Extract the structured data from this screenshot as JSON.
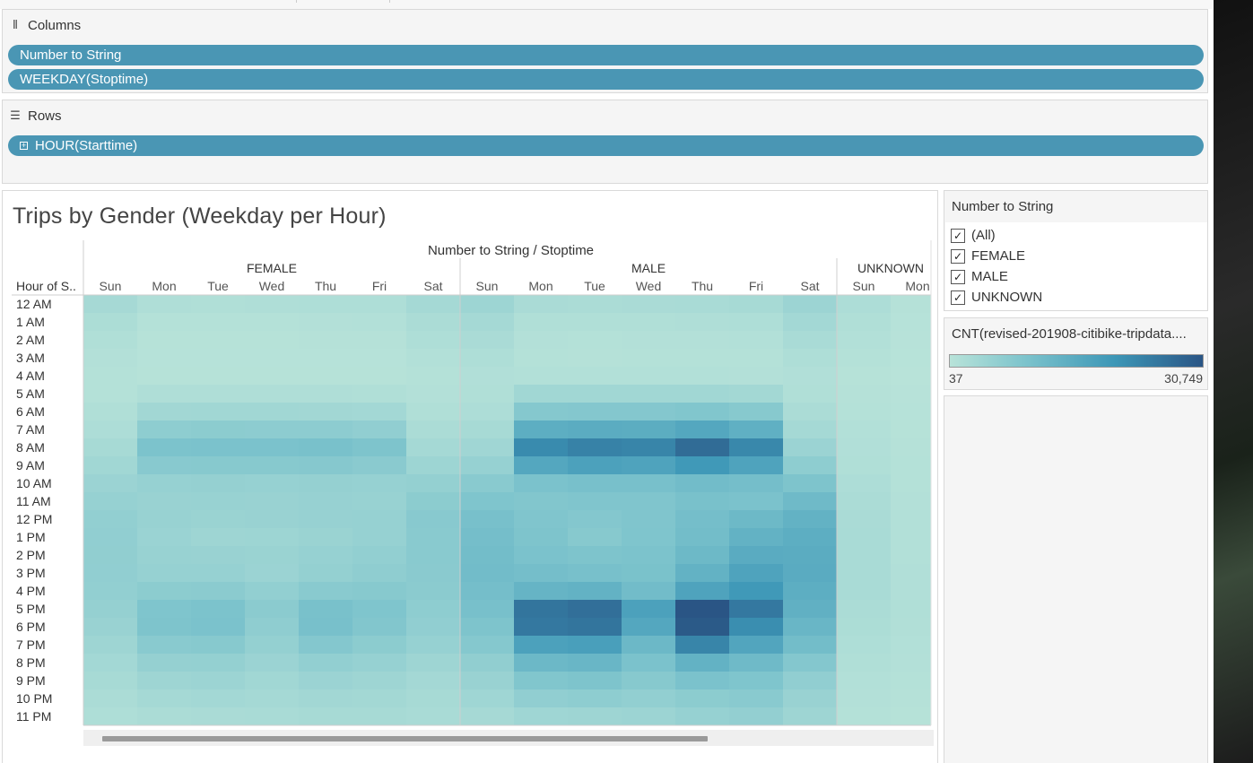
{
  "columns_shelf": {
    "label": "Columns",
    "pills": [
      "Number to String",
      "WEEKDAY(Stoptime)"
    ]
  },
  "rows_shelf": {
    "label": "Rows",
    "pills": [
      "HOUR(Starttime)"
    ]
  },
  "view": {
    "title": "Trips by Gender  (Weekday per Hour)",
    "header_title": "Number to String / Stoptime",
    "row_header": "Hour of S..",
    "groups": [
      "FEMALE",
      "MALE",
      "UNKNOWN"
    ],
    "days": [
      "Sun",
      "Mon",
      "Tue",
      "Wed",
      "Thu",
      "Fri",
      "Sat"
    ],
    "hours": [
      "12 AM",
      "1 AM",
      "2 AM",
      "3 AM",
      "4 AM",
      "5 AM",
      "6 AM",
      "7 AM",
      "8 AM",
      "9 AM",
      "10 AM",
      "11 AM",
      "12 PM",
      "1 PM",
      "2 PM",
      "3 PM",
      "4 PM",
      "5 PM",
      "6 PM",
      "7 PM",
      "8 PM",
      "9 PM",
      "10 PM",
      "11 PM"
    ]
  },
  "filter_card": {
    "title": "Number to String",
    "items": [
      {
        "label": "(All)",
        "checked": true
      },
      {
        "label": "FEMALE",
        "checked": true
      },
      {
        "label": "MALE",
        "checked": true
      },
      {
        "label": "UNKNOWN",
        "checked": true
      }
    ]
  },
  "legend_card": {
    "title": "CNT(revised-201908-citibike-tripdata....",
    "min_label": "37",
    "max_label": "30,749",
    "colors": [
      "#b8e3d9",
      "#7cc3cc",
      "#3d97b7",
      "#2a5585"
    ]
  },
  "chart_data": {
    "type": "heatmap",
    "title": "Trips by Gender  (Weekday per Hour)",
    "x_title": "Number to String / Stoptime",
    "y_label": "Hour of S..",
    "value_range": [
      37,
      30749
    ],
    "columns": [
      {
        "group": "FEMALE",
        "day": "Sun"
      },
      {
        "group": "FEMALE",
        "day": "Mon"
      },
      {
        "group": "FEMALE",
        "day": "Tue"
      },
      {
        "group": "FEMALE",
        "day": "Wed"
      },
      {
        "group": "FEMALE",
        "day": "Thu"
      },
      {
        "group": "FEMALE",
        "day": "Fri"
      },
      {
        "group": "FEMALE",
        "day": "Sat"
      },
      {
        "group": "MALE",
        "day": "Sun"
      },
      {
        "group": "MALE",
        "day": "Mon"
      },
      {
        "group": "MALE",
        "day": "Tue"
      },
      {
        "group": "MALE",
        "day": "Wed"
      },
      {
        "group": "MALE",
        "day": "Thu"
      },
      {
        "group": "MALE",
        "day": "Fri"
      },
      {
        "group": "MALE",
        "day": "Sat"
      },
      {
        "group": "UNKNOWN",
        "day": "Sun"
      },
      {
        "group": "UNKNOWN",
        "day": "Mon"
      }
    ],
    "rows": [
      "12 AM",
      "1 AM",
      "2 AM",
      "3 AM",
      "4 AM",
      "5 AM",
      "6 AM",
      "7 AM",
      "8 AM",
      "9 AM",
      "10 AM",
      "11 AM",
      "12 PM",
      "1 PM",
      "2 PM",
      "3 PM",
      "4 PM",
      "5 PM",
      "6 PM",
      "7 PM",
      "8 PM",
      "9 PM",
      "10 PM",
      "11 PM"
    ],
    "values": [
      [
        2800,
        1400,
        1300,
        1400,
        1500,
        1600,
        2900,
        4200,
        2200,
        2100,
        2200,
        2400,
        2600,
        4400,
        1800,
        500
      ],
      [
        1900,
        700,
        700,
        700,
        800,
        900,
        2100,
        3000,
        1300,
        1200,
        1300,
        1400,
        1600,
        3200,
        1200,
        300
      ],
      [
        1300,
        400,
        400,
        400,
        500,
        500,
        1500,
        2200,
        800,
        700,
        800,
        800,
        900,
        2300,
        900,
        200
      ],
      [
        800,
        300,
        300,
        300,
        300,
        300,
        900,
        1500,
        600,
        500,
        600,
        600,
        600,
        1600,
        600,
        150
      ],
      [
        600,
        400,
        400,
        400,
        400,
        400,
        600,
        1100,
        900,
        900,
        900,
        900,
        800,
        1100,
        400,
        100
      ],
      [
        700,
        1400,
        1400,
        1400,
        1400,
        1300,
        800,
        1200,
        3500,
        3500,
        3500,
        3500,
        3300,
        1300,
        500,
        200
      ],
      [
        1200,
        3400,
        3500,
        3500,
        3400,
        3200,
        1300,
        1800,
        7800,
        8000,
        8000,
        8500,
        7500,
        2000,
        700,
        300
      ],
      [
        1800,
        6500,
        6800,
        6700,
        6600,
        6000,
        2000,
        2600,
        14500,
        14800,
        14700,
        16000,
        14000,
        3000,
        900,
        400
      ],
      [
        2600,
        9300,
        9500,
        9400,
        9800,
        9000,
        3000,
        3700,
        22000,
        23500,
        23000,
        27000,
        22500,
        4500,
        1100,
        500
      ],
      [
        3600,
        7400,
        7600,
        7500,
        7700,
        7100,
        4200,
        5200,
        16000,
        17500,
        17000,
        19500,
        17000,
        6500,
        1300,
        600
      ],
      [
        4500,
        5200,
        5400,
        5300,
        5400,
        5200,
        5600,
        7200,
        9500,
        10000,
        10000,
        11000,
        10500,
        9000,
        1700,
        700
      ],
      [
        5200,
        4800,
        4900,
        4800,
        5100,
        5000,
        6800,
        8800,
        8300,
        8700,
        8600,
        9800,
        9500,
        11500,
        2000,
        800
      ],
      [
        5800,
        4900,
        4700,
        4800,
        5100,
        5300,
        7400,
        10000,
        8700,
        8000,
        8600,
        10500,
        11800,
        13500,
        2200,
        900
      ],
      [
        6000,
        4600,
        4000,
        4200,
        4700,
        5300,
        7200,
        10500,
        9000,
        7600,
        8800,
        10800,
        13500,
        14500,
        2300,
        950
      ],
      [
        6100,
        4900,
        4800,
        4700,
        5300,
        5900,
        7300,
        10800,
        9500,
        8900,
        9200,
        11800,
        15000,
        14800,
        2400,
        1000
      ],
      [
        6000,
        5300,
        5300,
        4500,
        5600,
        6300,
        7100,
        10900,
        10500,
        10000,
        9600,
        13500,
        17000,
        15000,
        2400,
        1050
      ],
      [
        5800,
        6800,
        6900,
        5800,
        7200,
        7500,
        6900,
        10500,
        13000,
        13500,
        11000,
        17000,
        19500,
        14500,
        2300,
        1100
      ],
      [
        5400,
        8800,
        9300,
        6900,
        9700,
        8800,
        6500,
        10000,
        25500,
        26500,
        17500,
        30749,
        25000,
        13800,
        2100,
        1200
      ],
      [
        4800,
        9000,
        9500,
        6400,
        10000,
        8300,
        6000,
        9000,
        25000,
        25500,
        16000,
        30000,
        21500,
        12500,
        1900,
        1150
      ],
      [
        4100,
        7200,
        7500,
        5600,
        8000,
        6800,
        5200,
        7800,
        17500,
        18000,
        12000,
        23000,
        16500,
        10800,
        1600,
        1000
      ],
      [
        3200,
        5400,
        5600,
        4500,
        5800,
        5200,
        4000,
        6100,
        12000,
        12500,
        9500,
        13500,
        11500,
        8000,
        1300,
        850
      ],
      [
        2600,
        4000,
        4300,
        3600,
        4500,
        4100,
        3100,
        4800,
        8500,
        9000,
        7500,
        9500,
        8800,
        6000,
        1000,
        700
      ],
      [
        2100,
        3000,
        3200,
        3000,
        3400,
        3300,
        2700,
        3800,
        6000,
        6500,
        5800,
        6800,
        7200,
        4800,
        800,
        550
      ],
      [
        1600,
        2000,
        2200,
        2300,
        2600,
        2700,
        2300,
        2800,
        3800,
        4100,
        4300,
        5200,
        5700,
        4000,
        600,
        400
      ]
    ]
  }
}
